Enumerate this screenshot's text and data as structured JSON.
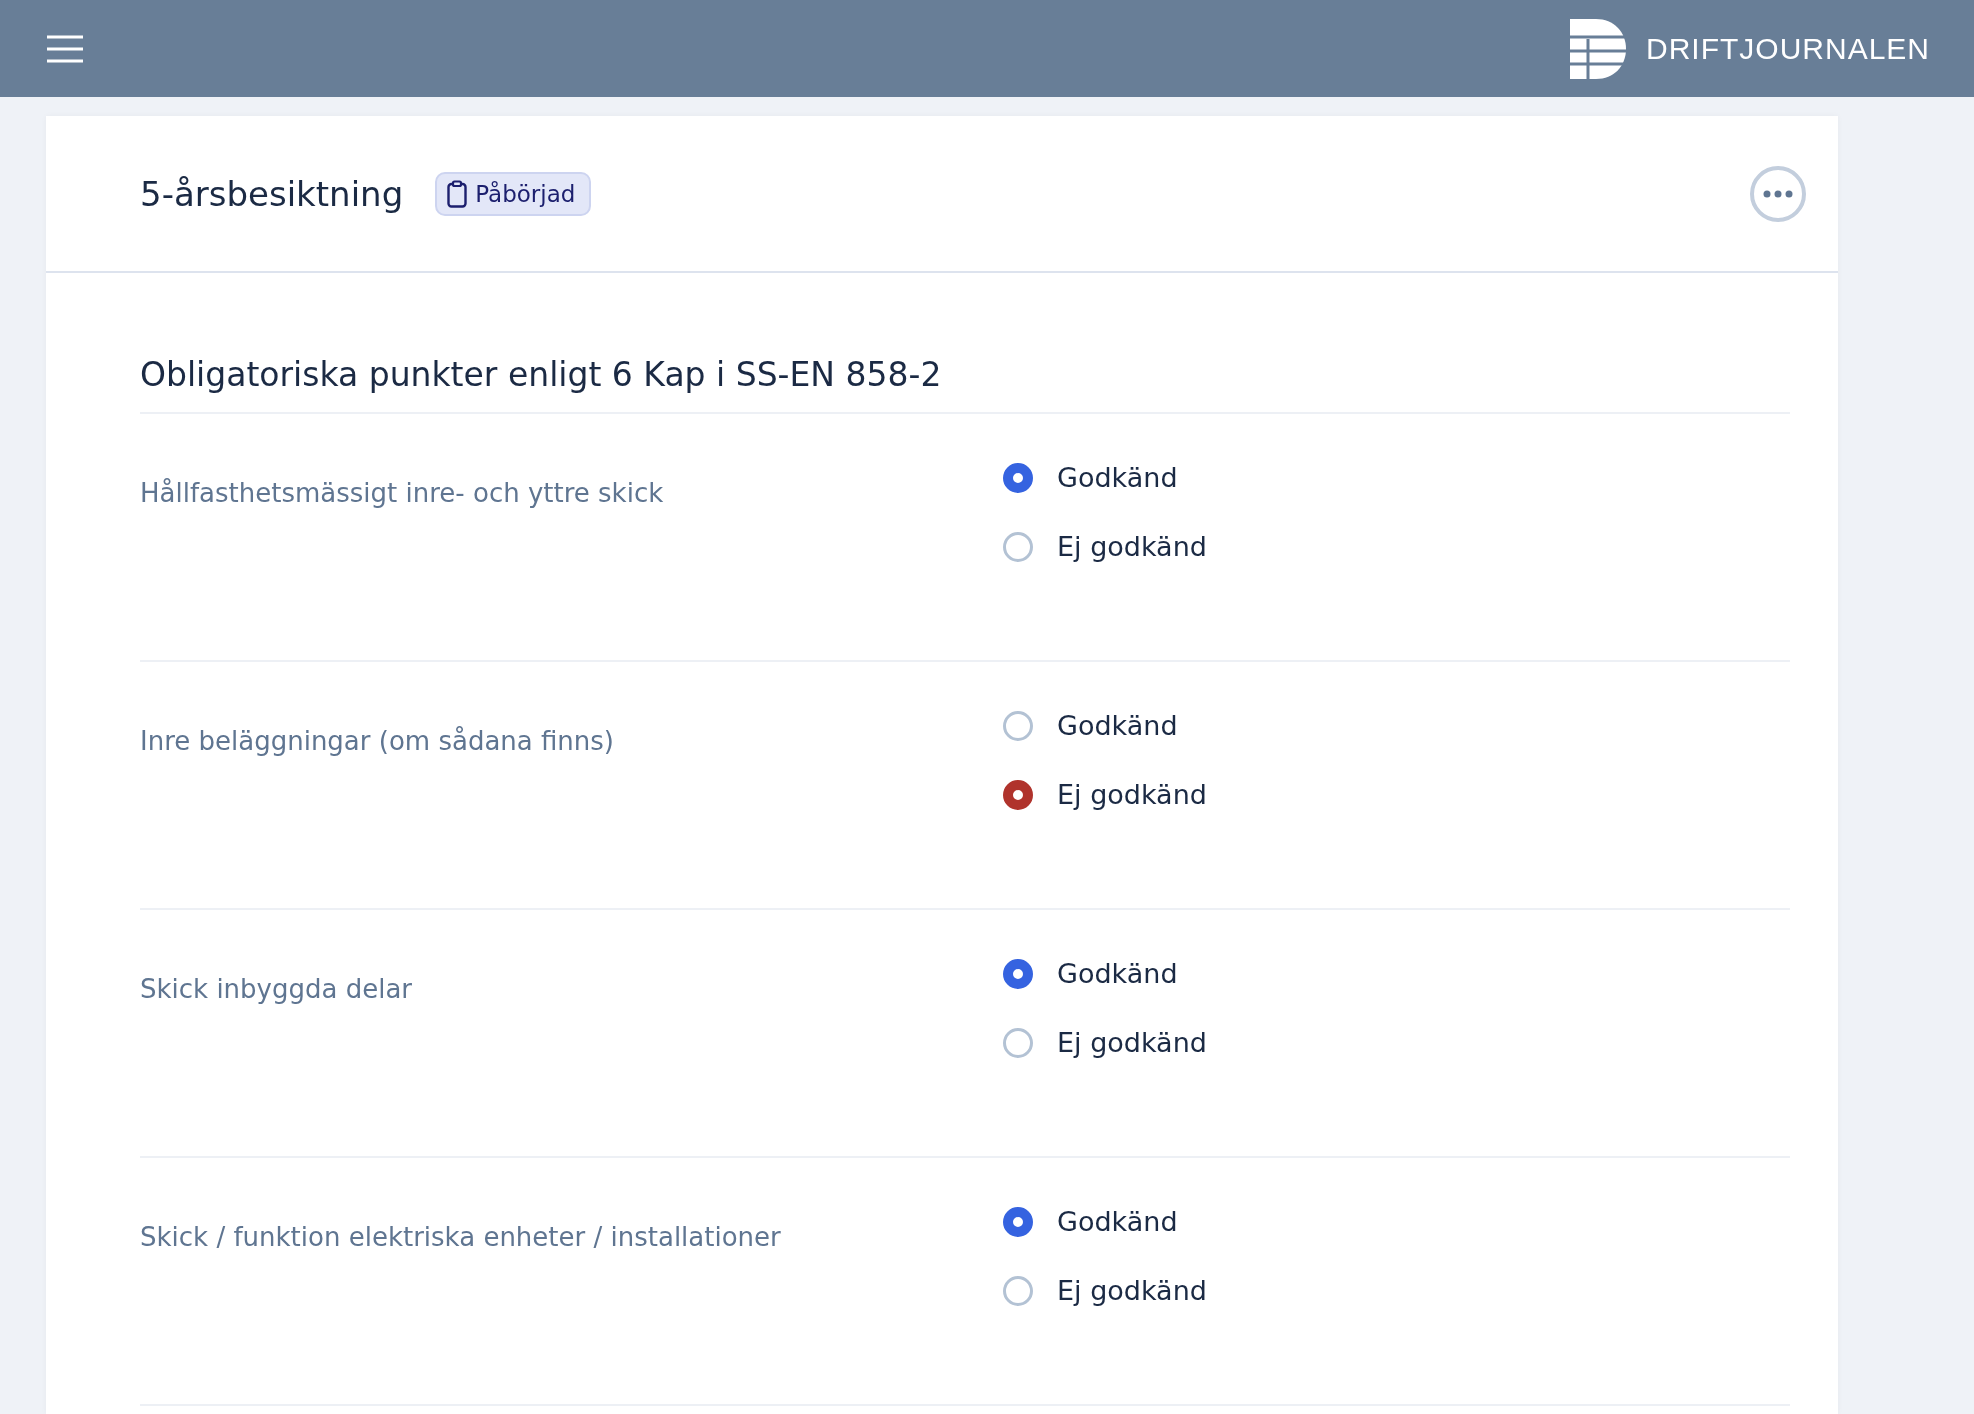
{
  "app_bar": {
    "brand": "DRIFTJOURNALEN"
  },
  "card": {
    "title": "5-årsbesiktning",
    "status": "Påbörjad"
  },
  "section": {
    "heading": "Obligatoriska punkter enligt 6 Kap i SS-EN 858-2",
    "items": [
      {
        "label": "Hållfasthetsmässigt inre- och yttre skick",
        "options": [
          {
            "label": "Godkänd",
            "kind": "pass",
            "selected": true
          },
          {
            "label": "Ej godkänd",
            "kind": "fail",
            "selected": false
          }
        ]
      },
      {
        "label": "Inre beläggningar (om sådana finns)",
        "options": [
          {
            "label": "Godkänd",
            "kind": "pass",
            "selected": false
          },
          {
            "label": "Ej godkänd",
            "kind": "fail",
            "selected": true
          }
        ]
      },
      {
        "label": "Skick inbyggda delar",
        "options": [
          {
            "label": "Godkänd",
            "kind": "pass",
            "selected": true
          },
          {
            "label": "Ej godkänd",
            "kind": "fail",
            "selected": false
          }
        ]
      },
      {
        "label": "Skick / funktion elektriska enheter / installationer",
        "options": [
          {
            "label": "Godkänd",
            "kind": "pass",
            "selected": true
          },
          {
            "label": "Ej godkänd",
            "kind": "fail",
            "selected": false
          }
        ]
      }
    ]
  }
}
